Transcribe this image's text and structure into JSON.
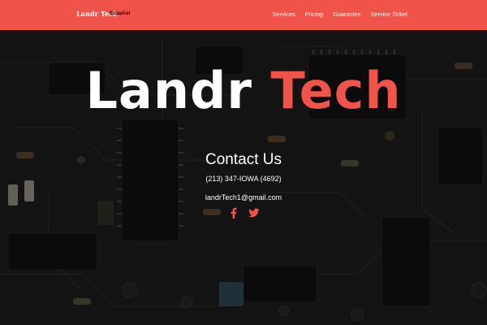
{
  "navbar": {
    "brand": "Landr Tech",
    "language_link": "Español",
    "links": [
      {
        "label": "Services"
      },
      {
        "label": "Pricing"
      },
      {
        "label": "Guarantee"
      },
      {
        "label": "Service Ticket"
      }
    ],
    "background_color": "#f05349"
  },
  "hero": {
    "title_part1": "Landr",
    "title_part2": "Tech",
    "title_accent_color": "#f05349",
    "background_image": "circuit-board",
    "contact": {
      "heading": "Contact Us",
      "phone": "(213) 347-IOWA (4692)",
      "email": "landrTech1@gmail.com"
    },
    "social": [
      {
        "icon": "facebook-icon"
      },
      {
        "icon": "twitter-icon"
      }
    ]
  }
}
